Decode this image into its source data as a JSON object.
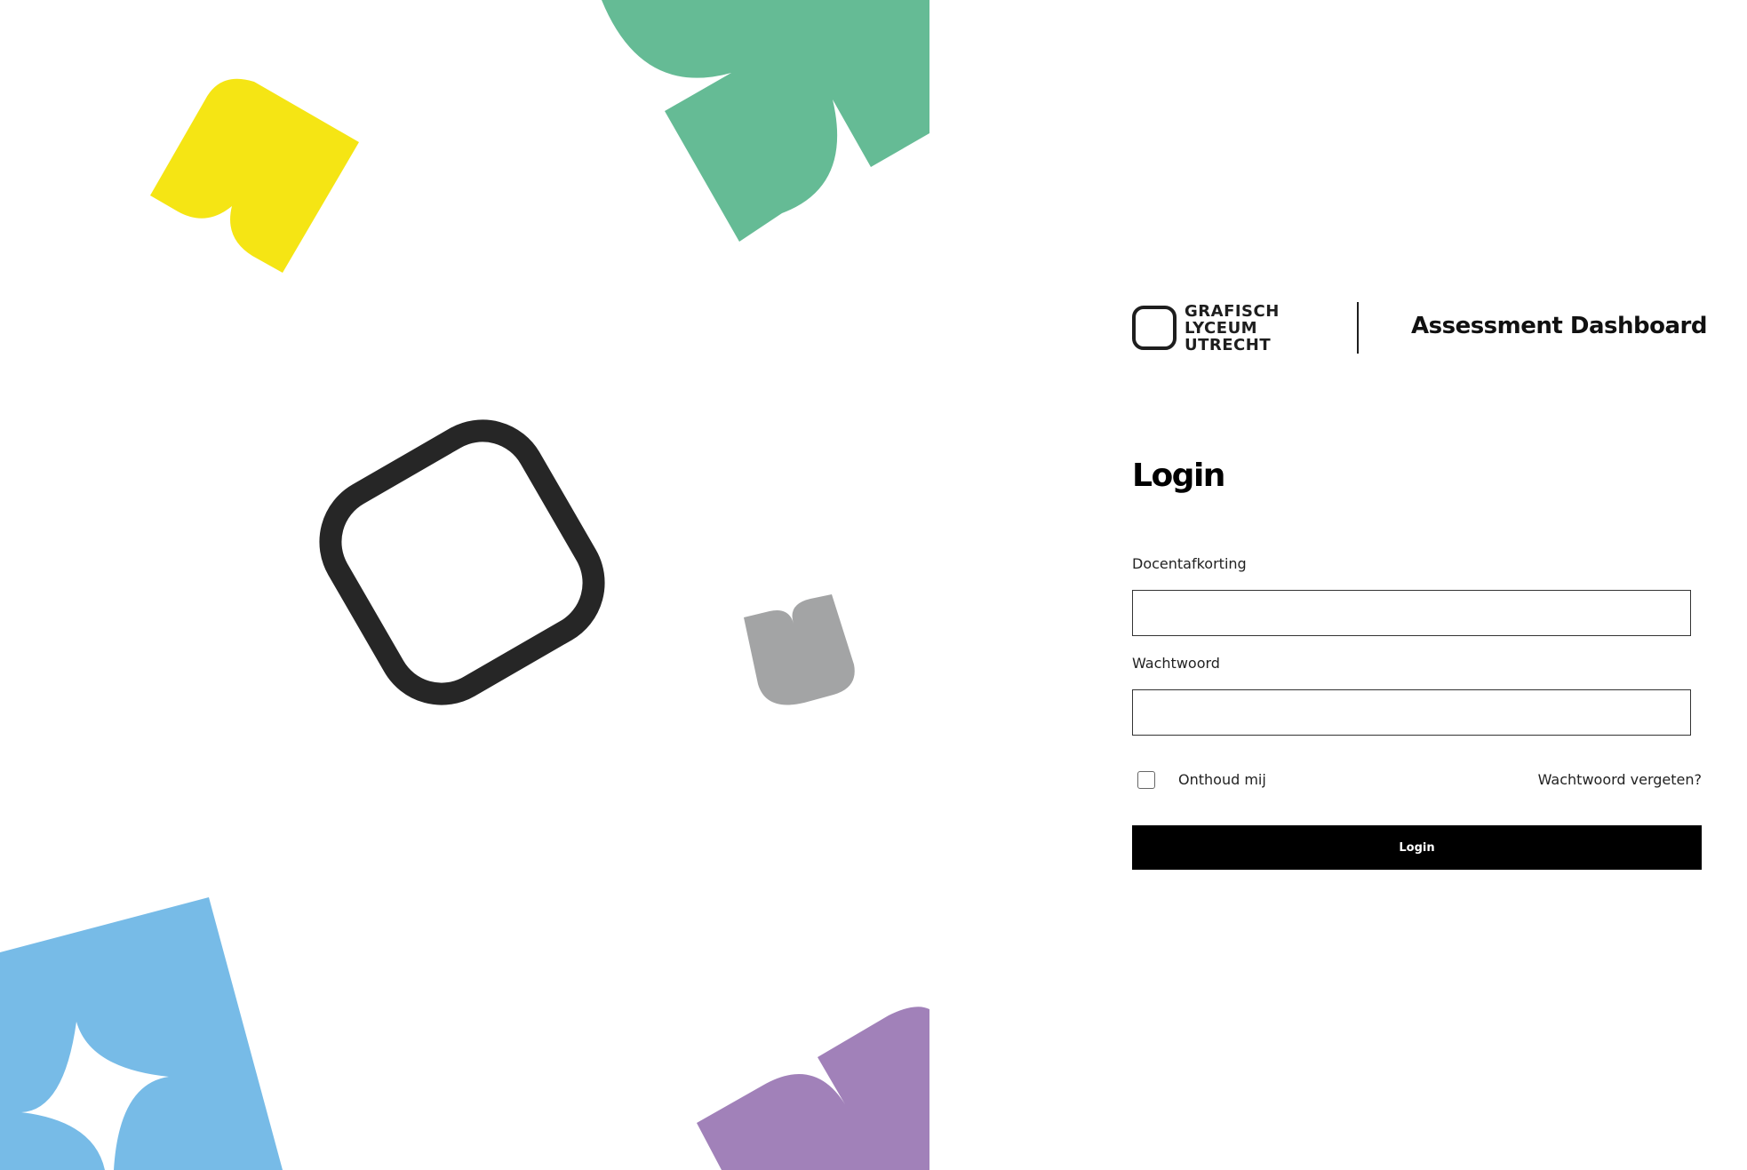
{
  "brand": {
    "line1": "GRAFISCH",
    "line2": "LYCEUM",
    "line3": "UTRECHT"
  },
  "app_title": "Assessment Dashboard",
  "login": {
    "heading": "Login",
    "username_label": "Docentafkorting",
    "username_value": "",
    "password_label": "Wachtwoord",
    "password_value": "",
    "remember_label": "Onthoud mij",
    "remember_checked": false,
    "forgot_link": "Wachtwoord vergeten?",
    "submit_label": "Login"
  },
  "decor": {
    "shapes": [
      {
        "name": "yellow-shape",
        "color": "#f5e514"
      },
      {
        "name": "green-shape",
        "color": "#65bb95"
      },
      {
        "name": "outline-square-shape",
        "color": "#262626"
      },
      {
        "name": "grey-shape",
        "color": "#a3a4a5"
      },
      {
        "name": "blue-shape",
        "color": "#77bbe7"
      },
      {
        "name": "purple-shape",
        "color": "#a181b9"
      }
    ]
  }
}
